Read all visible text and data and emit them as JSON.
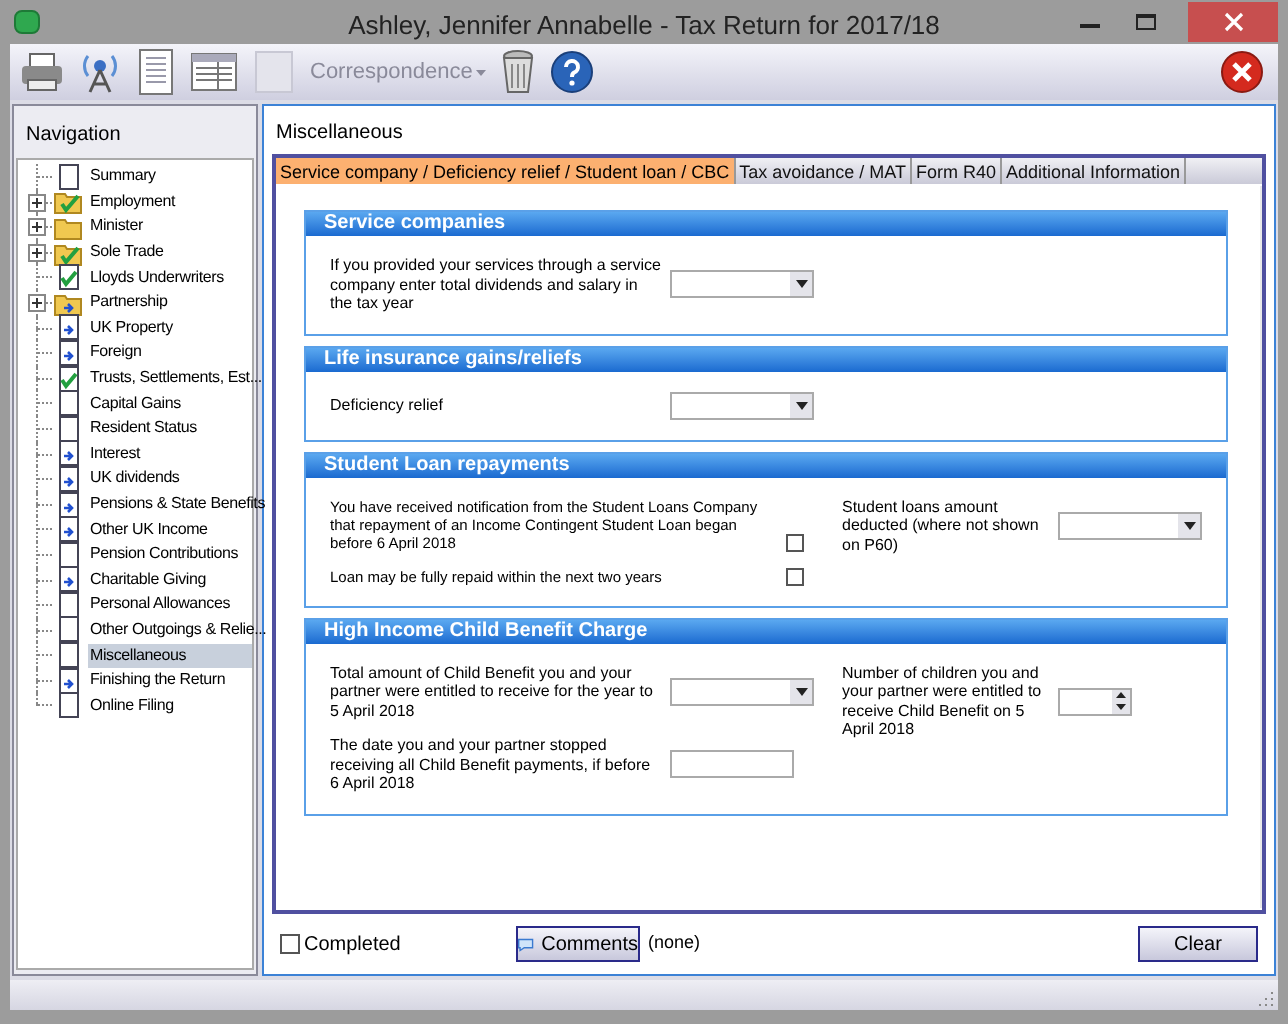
{
  "window": {
    "title": "Ashley, Jennifer Annabelle - Tax Return for 2017/18"
  },
  "toolbar": {
    "correspondence": "Correspondence"
  },
  "navigation": {
    "title": "Navigation",
    "items": [
      {
        "label": "Summary",
        "kind": "page",
        "selected": false
      },
      {
        "label": "Employment",
        "kind": "folder-check",
        "expanded": false,
        "selected": false
      },
      {
        "label": "Minister",
        "kind": "folder",
        "expanded": false,
        "selected": false
      },
      {
        "label": "Sole Trade",
        "kind": "folder-check",
        "expanded": false,
        "selected": false
      },
      {
        "label": "Lloyds Underwriters",
        "kind": "page-check",
        "selected": false
      },
      {
        "label": "Partnership",
        "kind": "folder-arrow",
        "expanded": false,
        "selected": false
      },
      {
        "label": "UK Property",
        "kind": "page-arrow",
        "selected": false
      },
      {
        "label": "Foreign",
        "kind": "page-arrow",
        "selected": false
      },
      {
        "label": "Trusts, Settlements, Est...",
        "kind": "page-check",
        "selected": false
      },
      {
        "label": "Capital Gains",
        "kind": "page",
        "selected": false
      },
      {
        "label": "Resident Status",
        "kind": "page",
        "selected": false
      },
      {
        "label": "Interest",
        "kind": "page-arrow",
        "selected": false
      },
      {
        "label": "UK dividends",
        "kind": "page-arrow",
        "selected": false
      },
      {
        "label": "Pensions & State Benefits",
        "kind": "page-arrow",
        "selected": false
      },
      {
        "label": "Other UK Income",
        "kind": "page-arrow",
        "selected": false
      },
      {
        "label": "Pension Contributions",
        "kind": "page",
        "selected": false
      },
      {
        "label": "Charitable Giving",
        "kind": "page-arrow",
        "selected": false
      },
      {
        "label": "Personal Allowances",
        "kind": "page",
        "selected": false
      },
      {
        "label": "Other Outgoings & Relie...",
        "kind": "page",
        "selected": false
      },
      {
        "label": "Miscellaneous",
        "kind": "page",
        "selected": true
      },
      {
        "label": "Finishing the Return",
        "kind": "page-arrow",
        "selected": false
      },
      {
        "label": "Online Filing",
        "kind": "page",
        "selected": false
      }
    ]
  },
  "content": {
    "title": "Miscellaneous",
    "tabs": [
      {
        "label": "Service company / Deficiency relief / Student loan / CBC",
        "selected": true
      },
      {
        "label": "Tax avoidance / MAT",
        "selected": false
      },
      {
        "label": "Form R40",
        "selected": false
      },
      {
        "label": "Additional Information",
        "selected": false
      }
    ],
    "sections": [
      {
        "title": "Service companies",
        "left": [
          {
            "kind": "dropdown",
            "label": "If you provided your services through a service company enter total dividends and salary in the tax year"
          }
        ]
      },
      {
        "title": "Life insurance gains/reliefs",
        "left": [
          {
            "kind": "dropdown",
            "label": "Deficiency relief"
          }
        ]
      },
      {
        "title": "Student Loan repayments",
        "left": [
          {
            "kind": "checkbox",
            "label": "You have received notification from the Student Loans Company that repayment of an Income Contingent Student Loan began before 6 April 2018",
            "checked": false
          },
          {
            "kind": "checkbox",
            "label": "Loan may be fully repaid within the next two years",
            "checked": false
          }
        ],
        "right": [
          {
            "kind": "dropdown",
            "label": "Student loans amount deducted (where not shown on P60)"
          }
        ]
      },
      {
        "title": "High Income Child Benefit Charge",
        "left": [
          {
            "kind": "dropdown",
            "label": "Total amount of Child Benefit you and your partner were entitled to receive for the year to 5 April 2018"
          },
          {
            "kind": "text",
            "label": "The date you and your partner stopped receiving all Child Benefit payments, if before 6 April 2018"
          }
        ],
        "right": [
          {
            "kind": "spinner",
            "label": "Number of children you and your partner were entitled to receive Child Benefit on 5 April 2018"
          }
        ]
      }
    ],
    "completed": {
      "label": "Completed",
      "checked": false
    },
    "comments": {
      "label": "Comments",
      "value": "(none)"
    },
    "clear": "Clear"
  }
}
